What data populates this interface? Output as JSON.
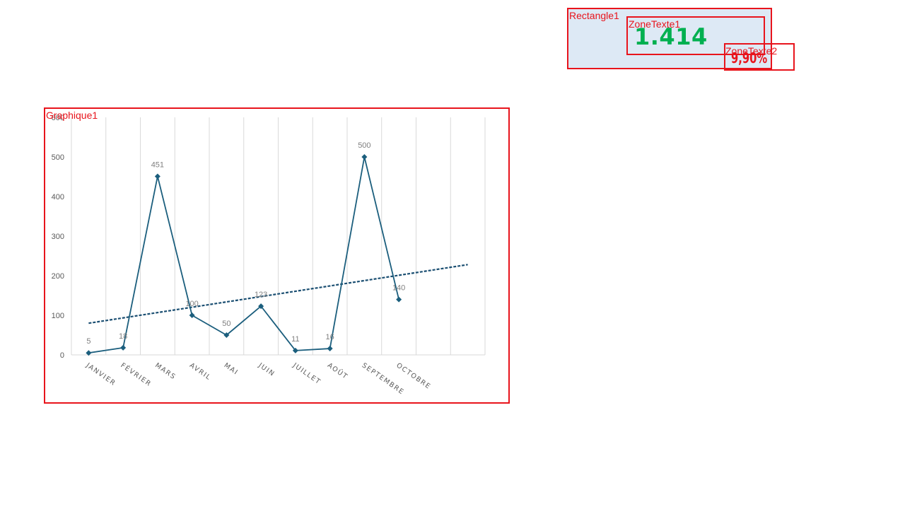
{
  "shapes": {
    "rectangle1": "Rectangle1",
    "zonetexte1": "ZoneTexte1",
    "zonetexte2": "ZoneTexte2",
    "graphique1": "Graphique1"
  },
  "kpi": {
    "value": "1.414",
    "percent": "9,90%"
  },
  "colors": {
    "frame": "#e8141c",
    "kpi_value": "#00b050",
    "kpi_percent": "#e8141c",
    "series_line": "#1b5e7d",
    "trend_line": "#1b4f72",
    "gridline": "#d9d9d9",
    "panel_fill": "#dde9f5"
  },
  "chart_data": {
    "type": "line",
    "categories": [
      "JANVIER",
      "FÉVRIER",
      "MARS",
      "AVRIL",
      "MAI",
      "JUIN",
      "JUILLET",
      "AOÛT",
      "SEPTEMBRE",
      "OCTOBRE",
      "",
      ""
    ],
    "series": [
      {
        "values": [
          5,
          18,
          451,
          100,
          50,
          123,
          11,
          16,
          500,
          140,
          null,
          null
        ],
        "data_labels": [
          "5",
          "18",
          "451",
          "100",
          "50",
          "123",
          "11",
          "16",
          "500",
          "140"
        ],
        "marker": "diamond"
      }
    ],
    "trendline": {
      "type": "linear",
      "style": "dashed",
      "values": [
        80,
        228
      ]
    },
    "yticks": [
      0,
      100,
      200,
      300,
      400,
      500,
      600
    ],
    "ylim": [
      0,
      600
    ],
    "grid": "vertical",
    "legend": "none",
    "title": "",
    "xlabel": "",
    "ylabel": ""
  }
}
